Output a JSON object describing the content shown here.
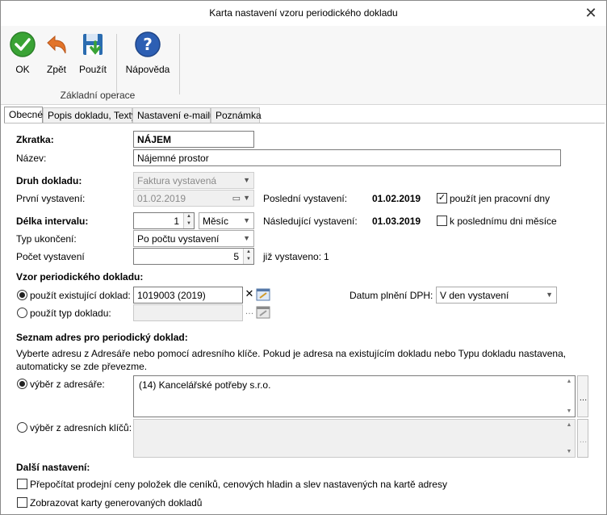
{
  "window": {
    "title": "Karta nastavení vzoru periodického dokladu"
  },
  "ribbon": {
    "ok": "OK",
    "back": "Zpět",
    "use": "Použít",
    "help": "Nápověda",
    "group": "Základní operace"
  },
  "tabs": [
    "Obecné",
    "Popis dokladu, Texty",
    "Nastavení e-mailu",
    "Poznámka"
  ],
  "form": {
    "zkratka_label": "Zkratka:",
    "zkratka_value": "NÁJEM",
    "nazev_label": "Název:",
    "nazev_value": "Nájemné prostor",
    "druh_label": "Druh dokladu:",
    "druh_value": "Faktura vystavená",
    "prvni_label": "První vystavení:",
    "prvni_value": "01.02.2019",
    "posledni_label": "Poslední vystavení:",
    "posledni_value": "01.02.2019",
    "pracovni_label": "použít jen pracovní dny",
    "delka_label": "Délka intervalu:",
    "delka_value": "1",
    "jednotka_value": "Měsíc",
    "nasledujici_label": "Následující vystavení:",
    "nasledujici_value": "01.03.2019",
    "poslednimu_label": "k poslednímu dni měsíce",
    "ukonceni_label": "Typ ukončení:",
    "ukonceni_value": "Po počtu vystavení",
    "pocet_label": "Počet vystavení",
    "pocet_value": "5",
    "vystaveno_label": "již vystaveno:",
    "vystaveno_value": "1"
  },
  "vzor": {
    "heading": "Vzor periodického dokladu:",
    "existujici_label": "použít existující doklad:",
    "existujici_value": "1019003 (2019)",
    "typ_label": "použít typ dokladu:",
    "dph_label": "Datum plnění DPH:",
    "dph_value": "V den vystavení"
  },
  "adresy": {
    "heading": "Seznam adres pro periodický doklad:",
    "description": "Vyberte adresu z Adresáře nebo pomocí adresního klíče. Pokud je adresa na existujícím dokladu nebo Typu dokladu nastavena, automaticky se zde převezme.",
    "adresar_label": "výběr z adresáře:",
    "adresar_value": "(14) Kancelářské potřeby s.r.o.",
    "klice_label": "výběr z adresních klíčů:"
  },
  "dalsi": {
    "heading": "Další nastavení:",
    "prepocitat_label": "Přepočítat prodejní ceny položek dle ceníků, cenových hladin a slev nastavených na kartě adresy",
    "zobrazovat_label": "Zobrazovat karty generovaných dokladů"
  },
  "colors": {
    "ok_green": "#3aa335",
    "back_orange": "#e2742a",
    "help_blue": "#2d5fb3"
  }
}
